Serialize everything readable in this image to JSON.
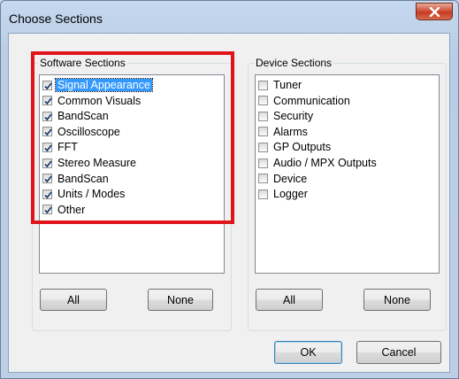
{
  "window": {
    "title": "Choose Sections"
  },
  "software": {
    "label": "Software Sections",
    "items": [
      {
        "label": "Signal Appearance",
        "checked": true,
        "selected": true
      },
      {
        "label": "Common Visuals",
        "checked": true
      },
      {
        "label": "BandScan",
        "checked": true
      },
      {
        "label": "Oscilloscope",
        "checked": true
      },
      {
        "label": "FFT",
        "checked": true
      },
      {
        "label": "Stereo Measure",
        "checked": true
      },
      {
        "label": "BandScan",
        "checked": true
      },
      {
        "label": "Units / Modes",
        "checked": true
      },
      {
        "label": "Other",
        "checked": true
      }
    ],
    "all_label": "All",
    "none_label": "None"
  },
  "device": {
    "label": "Device Sections",
    "items": [
      {
        "label": "Tuner",
        "checked": false
      },
      {
        "label": "Communication",
        "checked": false
      },
      {
        "label": "Security",
        "checked": false
      },
      {
        "label": "Alarms",
        "checked": false
      },
      {
        "label": "GP Outputs",
        "checked": false
      },
      {
        "label": "Audio / MPX Outputs",
        "checked": false
      },
      {
        "label": "Device",
        "checked": false
      },
      {
        "label": "Logger",
        "checked": false
      }
    ],
    "all_label": "All",
    "none_label": "None"
  },
  "footer": {
    "ok_label": "OK",
    "cancel_label": "Cancel"
  },
  "colors": {
    "highlight": "#e0151b",
    "selection": "#3399ff",
    "close": "#c63a20"
  }
}
